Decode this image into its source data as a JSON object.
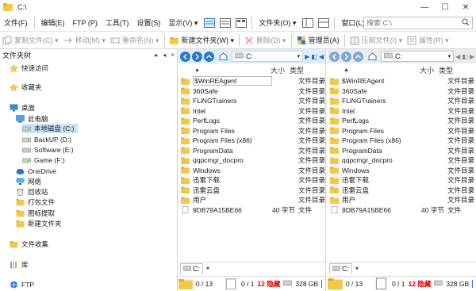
{
  "window": {
    "title": "C:\\"
  },
  "menu": {
    "items": [
      "文件(F)",
      "编辑(E)",
      "FTP (P)",
      "工具(T)",
      "设置(S)",
      "显示(V) ▾",
      "文件夹(O) ▾",
      "窗口(L) ▾"
    ]
  },
  "search": {
    "placeholder": "搜索 C:\\"
  },
  "toolbar": {
    "copy": "复制文件(C) ▾",
    "move": "移动(M) ▾",
    "rename": "重命名(N) ▾",
    "new_folder": "新建文件夹(W) ▾",
    "delete": "删除(D) ▾",
    "admin": "管理员(A)",
    "compress": "压缩文件(I) ▾",
    "properties": "属性(R) ▾"
  },
  "tree": {
    "header": "文件夹树",
    "header_buttons": [
      "▸",
      "◂",
      "×"
    ],
    "items": [
      {
        "label": "快速访问",
        "icon": "star-icon"
      },
      {
        "label": "收藏夹",
        "icon": "star-icon"
      },
      {
        "label": "桌面",
        "icon": "desktop-icon"
      },
      {
        "label": "此电脑",
        "icon": "computer-icon"
      },
      {
        "label": "本地磁盘 (C:)",
        "icon": "drive-icon",
        "selected": true
      },
      {
        "label": "BackUP (D:)",
        "icon": "drive-icon"
      },
      {
        "label": "Software (E:)",
        "icon": "drive-icon"
      },
      {
        "label": "Game (F:)",
        "icon": "drive-icon"
      },
      {
        "label": "OneDrive",
        "icon": "cloud-icon"
      },
      {
        "label": "网络",
        "icon": "network-icon"
      },
      {
        "label": "回收站",
        "icon": "recycle-bin-icon"
      },
      {
        "label": "打包文件",
        "icon": "folder-icon"
      },
      {
        "label": "图标提取",
        "icon": "folder-icon"
      },
      {
        "label": "新建文件夹",
        "icon": "folder-icon"
      },
      {
        "label": "文件收集",
        "icon": "folder-icon"
      },
      {
        "label": "库",
        "icon": "library-icon"
      },
      {
        "label": "FTP",
        "icon": "ftp-icon"
      }
    ]
  },
  "panes": [
    {
      "path": "C:",
      "columns": {
        "size": "大小",
        "type": "类型"
      },
      "tab": "C:",
      "status": {
        "sel_folders": "0 / 13",
        "sel_files": "0 / 1",
        "hidden": "12 隐藏",
        "free": "328 GB"
      },
      "end_buttons": [
        "▶",
        "◧",
        "◀"
      ],
      "files": [
        {
          "name": "$WinREAgent",
          "size": "",
          "type": "文件目录"
        },
        {
          "name": "360Safe",
          "size": "",
          "type": "文件目录"
        },
        {
          "name": "FLiNGTrainers",
          "size": "",
          "type": "文件目录"
        },
        {
          "name": "Intel",
          "size": "",
          "type": "文件目录"
        },
        {
          "name": "PerfLogs",
          "size": "",
          "type": "文件目录"
        },
        {
          "name": "Program Files",
          "size": "",
          "type": "文件目录"
        },
        {
          "name": "Program Files (x86)",
          "size": "",
          "type": "文件目录"
        },
        {
          "name": "ProgramData",
          "size": "",
          "type": "文件目录"
        },
        {
          "name": "qqpcmgr_docpro",
          "size": "",
          "type": "文件目录"
        },
        {
          "name": "Windows",
          "size": "",
          "type": "文件目录"
        },
        {
          "name": "迅雷下载",
          "size": "",
          "type": "文件目录"
        },
        {
          "name": "迅雷云盘",
          "size": "",
          "type": "文件目录"
        },
        {
          "name": "用户",
          "size": "",
          "type": "文件目录"
        },
        {
          "name": "9DB79A15BE66",
          "size": "40 字节",
          "type": "文件",
          "isFile": true
        }
      ]
    },
    {
      "path": "C:",
      "columns": {
        "size": "大小",
        "type": "类型"
      },
      "tab": "C:",
      "status": {
        "sel_folders": "0 / 13",
        "sel_files": "0 / 1",
        "hidden": "12 隐藏",
        "free": "328 GB"
      },
      "end_buttons": [
        "◀",
        "◧",
        "▶"
      ],
      "files": [
        {
          "name": "$WinREAgent",
          "size": "",
          "type": "文件目录"
        },
        {
          "name": "360Safe",
          "size": "",
          "type": "文件目录"
        },
        {
          "name": "FLiNGTrainers",
          "size": "",
          "type": "文件目录"
        },
        {
          "name": "Intel",
          "size": "",
          "type": "文件目录"
        },
        {
          "name": "PerfLogs",
          "size": "",
          "type": "文件目录"
        },
        {
          "name": "Program Files",
          "size": "",
          "type": "文件目录"
        },
        {
          "name": "Program Files (x86)",
          "size": "",
          "type": "文件目录"
        },
        {
          "name": "ProgramData",
          "size": "",
          "type": "文件目录"
        },
        {
          "name": "qqpcmgr_docpro",
          "size": "",
          "type": "文件目录"
        },
        {
          "name": "Windows",
          "size": "",
          "type": "文件目录"
        },
        {
          "name": "迅雷下载",
          "size": "",
          "type": "文件目录"
        },
        {
          "name": "迅雷云盘",
          "size": "",
          "type": "文件目录"
        },
        {
          "name": "用户",
          "size": "",
          "type": "文件目录"
        },
        {
          "name": "9DB79A15BE66",
          "size": "40 字节",
          "type": "文件",
          "isFile": true
        }
      ]
    }
  ],
  "colors": {
    "folder": "#f2c84b",
    "accent": "#2b76d2",
    "nav_bg": "#dceefc",
    "hidden": "#d00000"
  }
}
